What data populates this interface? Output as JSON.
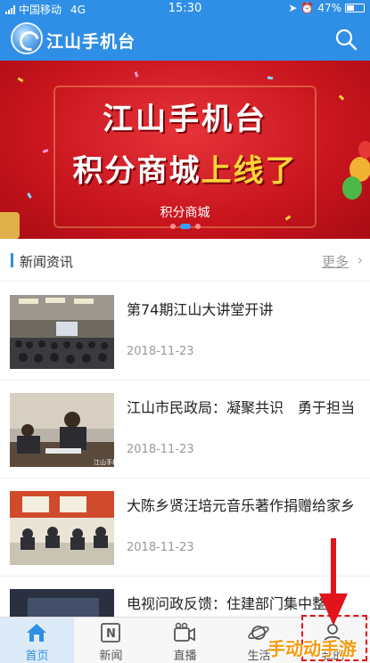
{
  "status_bar": {
    "carrier": "中国移动",
    "network": "4G",
    "time": "15:30",
    "battery": "47%",
    "battery_level": 0.47
  },
  "header": {
    "title": "江山手机台",
    "logo_icon": "app-logo-icon",
    "search_icon": "search-icon"
  },
  "banner": {
    "line1": "江山手机台",
    "line2_white": "积分商城",
    "line2_yellow": "上线了",
    "caption": "积分商城",
    "slide_count": 3,
    "active_slide": 2
  },
  "section": {
    "title": "新闻资讯",
    "more_label": "更多"
  },
  "news": [
    {
      "title": "第74期江山大讲堂开讲",
      "date": "2018-11-23"
    },
    {
      "title": "江山市民政局：凝聚共识　勇于担当",
      "date": "2018-11-23"
    },
    {
      "title": "大陈乡贤汪培元音乐著作捐赠给家乡",
      "date": "2018-11-23"
    },
    {
      "title": "电视问政反馈：住建部门集中整治",
      "date": ""
    }
  ],
  "tabbar": {
    "tabs": [
      {
        "label": "首页",
        "icon": "home-icon",
        "active": true
      },
      {
        "label": "新闻",
        "icon": "news-icon",
        "active": false
      },
      {
        "label": "直播",
        "icon": "video-icon",
        "active": false
      },
      {
        "label": "生活",
        "icon": "planet-icon",
        "active": false
      },
      {
        "label": "我的",
        "icon": "user-icon",
        "active": false
      }
    ]
  },
  "overlay": {
    "watermark": "手动动手游",
    "accent_color": "#e1141b"
  },
  "colors": {
    "brand_blue": "#2f8fe6",
    "banner_red": "#c8141d",
    "banner_yellow": "#ffd53a"
  }
}
